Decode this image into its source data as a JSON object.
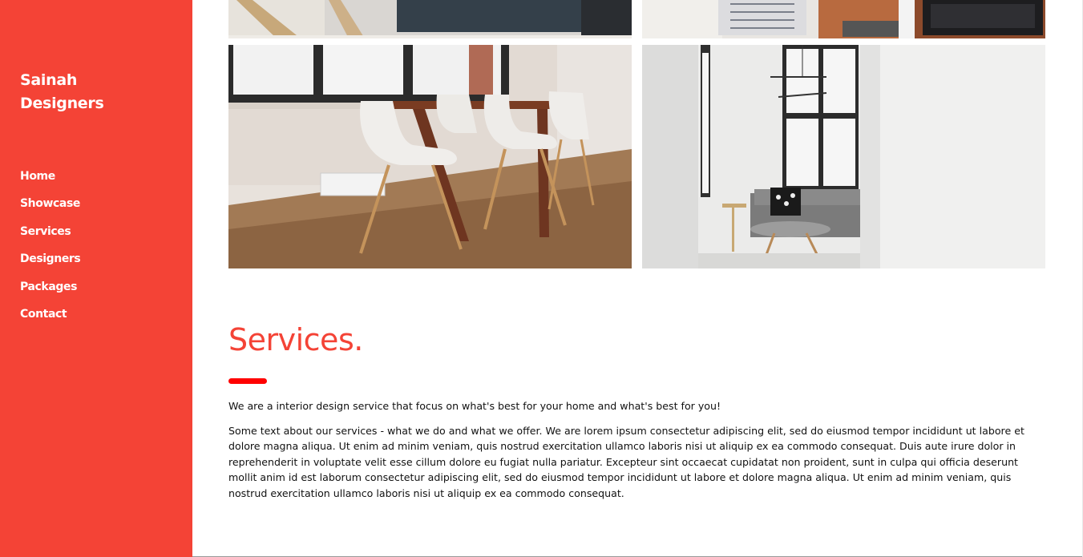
{
  "brand": {
    "line1": "Sainah",
    "line2": "Designers"
  },
  "nav": [
    {
      "label": "Home"
    },
    {
      "label": "Showcase"
    },
    {
      "label": "Services"
    },
    {
      "label": "Designers"
    },
    {
      "label": "Packages"
    },
    {
      "label": "Contact"
    }
  ],
  "colors": {
    "accent": "#f44336",
    "bar": "#ff0000",
    "text": "#111111"
  },
  "services": {
    "title": "Services.",
    "intro": "We are a interior design service that focus on what's best for your home and what's best for you!",
    "body": "Some text about our services - what we do and what we offer. We are lorem ipsum consectetur adipiscing elit, sed do eiusmod tempor incididunt ut labore et dolore magna aliqua. Ut enim ad minim veniam, quis nostrud exercitation ullamco laboris nisi ut aliquip ex ea commodo consequat. Duis aute irure dolor in reprehenderit in voluptate velit esse cillum dolore eu fugiat nulla pariatur. Excepteur sint occaecat cupidatat non proident, sunt in culpa qui officia deserunt mollit anim id est laborum consectetur adipiscing elit, sed do eiusmod tempor incididunt ut labore et dolore magna aliqua. Ut enim ad minim veniam, quis nostrud exercitation ullamco laboris nisi ut aliquip ex ea commodo consequat."
  }
}
